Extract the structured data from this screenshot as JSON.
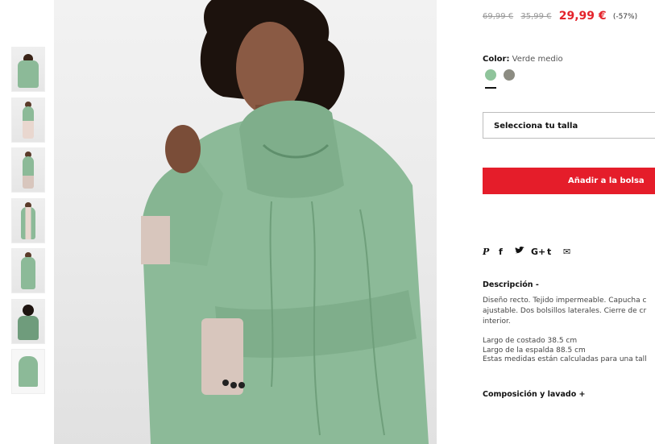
{
  "pricing": {
    "original_price": "69,99 €",
    "previous_price": "35,99 €",
    "current_price": "29,99 €",
    "discount": "(-57%)"
  },
  "color": {
    "label": "Color:",
    "value": "Verde medio",
    "swatches": [
      {
        "name": "Verde medio",
        "hex": "#8fc49b",
        "selected": true
      },
      {
        "name": "Gris",
        "hex": "#8c8c82",
        "selected": false
      }
    ]
  },
  "size_select": {
    "placeholder": "Selecciona tu talla"
  },
  "add_to_bag": {
    "label": "Añadir a la bolsa"
  },
  "social": {
    "pinterest": "P",
    "facebook": "f",
    "twitter": "✓",
    "googleplus": "G+",
    "tumblr": "t",
    "email": "✉"
  },
  "description": {
    "title": "Descripción -",
    "lines": [
      "Diseño recto. Tejido impermeable. Capucha c",
      "ajustable. Dos bolsillos laterales. Cierre de cr",
      "interior."
    ],
    "measures": [
      "Largo de costado 38.5 cm",
      "Largo de la espalda 88.5 cm",
      "Estas medidas están calculadas para una tall"
    ]
  },
  "composition": {
    "label": "Composición y lavado +"
  },
  "colors": {
    "coat_green": "#8cba98",
    "coat_dark": "#5f8f6c",
    "sale_red": "#e51d2a"
  }
}
